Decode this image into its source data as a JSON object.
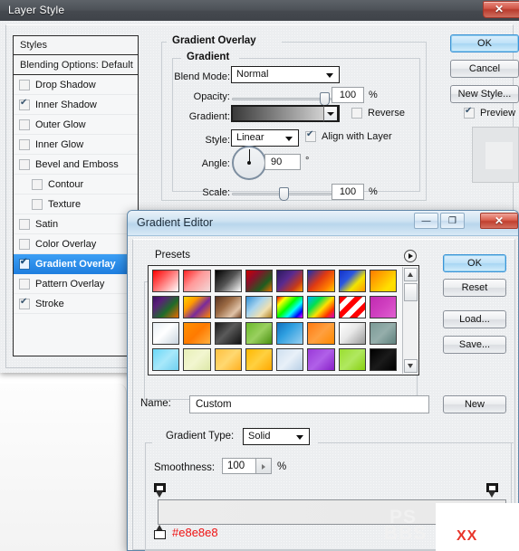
{
  "layer_style": {
    "title": "Layer Style",
    "close_glyph": "✕",
    "styles_panel": {
      "header": "Styles",
      "blending_options": "Blending Options: Default",
      "items": [
        {
          "label": "Drop Shadow",
          "checked": false,
          "indent": false,
          "selected": false
        },
        {
          "label": "Inner Shadow",
          "checked": true,
          "indent": false,
          "selected": false
        },
        {
          "label": "Outer Glow",
          "checked": false,
          "indent": false,
          "selected": false
        },
        {
          "label": "Inner Glow",
          "checked": false,
          "indent": false,
          "selected": false
        },
        {
          "label": "Bevel and Emboss",
          "checked": false,
          "indent": false,
          "selected": false
        },
        {
          "label": "Contour",
          "checked": false,
          "indent": true,
          "selected": false
        },
        {
          "label": "Texture",
          "checked": false,
          "indent": true,
          "selected": false
        },
        {
          "label": "Satin",
          "checked": false,
          "indent": false,
          "selected": false
        },
        {
          "label": "Color Overlay",
          "checked": false,
          "indent": false,
          "selected": false
        },
        {
          "label": "Gradient Overlay",
          "checked": true,
          "indent": false,
          "selected": true
        },
        {
          "label": "Pattern Overlay",
          "checked": false,
          "indent": false,
          "selected": false
        },
        {
          "label": "Stroke",
          "checked": true,
          "indent": false,
          "selected": false
        }
      ]
    },
    "panel": {
      "group_title": "Gradient Overlay",
      "subgroup_title": "Gradient",
      "blend_mode_label": "Blend Mode:",
      "blend_mode_value": "Normal",
      "opacity_label": "Opacity:",
      "opacity_value": "100",
      "opacity_unit": "%",
      "gradient_label": "Gradient:",
      "reverse_label": "Reverse",
      "reverse_checked": false,
      "style_label": "Style:",
      "style_value": "Linear",
      "align_label": "Align with Layer",
      "align_checked": true,
      "angle_label": "Angle:",
      "angle_value": "90",
      "angle_unit": "°",
      "scale_label": "Scale:",
      "scale_value": "100",
      "scale_unit": "%"
    },
    "buttons": {
      "ok": "OK",
      "cancel": "Cancel",
      "new_style": "New Style...",
      "preview_label": "Preview",
      "preview_checked": true
    }
  },
  "gradient_editor": {
    "title": "Gradient Editor",
    "window_buttons": {
      "minimize": "—",
      "maximize": "❐",
      "close": "✕"
    },
    "presets": {
      "label": "Presets",
      "menu_icon": "play-arrow-icon",
      "swatches": [
        "linear-gradient(135deg,#ff0000 0%,#ff5555 35%,#ffffff 100%)",
        "linear-gradient(135deg,#ff2222 0%,#ff9999 45%,#f2d9d9 100%)",
        "linear-gradient(135deg,#000000 0%,#555555 50%,#ffffff 100%)",
        "linear-gradient(135deg,#cc0000 0%,#8b0f2a 30%,#1f5c1f 70%,#e86a00 100%)",
        "linear-gradient(135deg,#2b1a5e 0%,#5a2a8f 40%,#c73a18 75%,#ff9900 100%)",
        "linear-gradient(135deg,#1a2fb0 0%,#e03a12 45%,#ff7a00 75%,#ffcc00 100%)",
        "linear-gradient(135deg,#1433c8 0%,#2b57e0 35%,#f2e400 65%,#ff9a00 100%)",
        "linear-gradient(135deg,#ff7a00 0%,#ffb000 40%,#ffe000 75%,#ffd400 100%)",
        "linear-gradient(135deg,#3b1060 0%,#5a1f7a 25%,#1f6b2a 60%,#e86a00 100%)",
        "linear-gradient(135deg,#ffd400 0%,#ff9a00 30%,#7a2a9a 60%,#ff8800 100%)",
        "linear-gradient(135deg,#5a3420 0%,#9c6b45 40%,#e0c3a8 75%,#7a4a2a 100%)",
        "linear-gradient(135deg,#2f8fd6 0%,#a8d4ee 40%,#f0e0b0 70%,#b08020 100%)",
        "linear-gradient(135deg,#ff0000 0%,#ffff00 20%,#00ff00 45%,#00ffff 65%,#0000ff 85%,#ff00ff 100%)",
        "linear-gradient(135deg,#00b0ff 0%,#00e050 30%,#ffe000 55%,#ff3000 80%,#cc00cc 100%)",
        "repeating-linear-gradient(135deg,#ff0000 0 6px,#ffffff 6px 12px)",
        "linear-gradient(135deg,#c02ab0 0%,#d040c0 50%,#e060d0 100%)",
        "linear-gradient(135deg,#e8eef4 0%,#ffffff 45%,#c8d4de 100%)",
        "linear-gradient(135deg,#ff9000 0%,#ff7a00 50%,#ffb040 100%)",
        "linear-gradient(135deg,#1a1a1a 0%,#5a5a5a 45%,#111111 100%)",
        "linear-gradient(135deg,#6aba2a 0%,#9ad060 50%,#4a9010 100%)",
        "linear-gradient(135deg,#1070c0 0%,#2f9fe0 40%,#9ad0f0 100%)",
        "linear-gradient(135deg,#ff7a10 0%,#ffa040 50%,#ff8800 100%)",
        "linear-gradient(135deg,#ffffff 0%,#e8e8e8 45%,#9a9a9a 100%)",
        "linear-gradient(135deg,#7a9a96 0%,#95aeab 50%,#5e807c 100%)",
        "linear-gradient(135deg,#6ad8f8 0%,#a8e8fa 50%,#70d0f0 100%)",
        "linear-gradient(135deg,#e8f0b8 0%,#f2f6d0 50%,#dde8a8 100%)",
        "linear-gradient(135deg,#ffc040 0%,#ffd870 50%,#ffb020 100%)",
        "linear-gradient(135deg,#ffb800 0%,#ffd040 50%,#ffa800 100%)",
        "linear-gradient(135deg,#cfe0f0 0%,#e8f0f8 50%,#b8cfe6 100%)",
        "linear-gradient(135deg,#9a3ad8 0%,#b060e8 50%,#8820c8 100%)",
        "linear-gradient(135deg,#9ade30 0%,#b0e860 50%,#88d010 100%)",
        "linear-gradient(135deg,#000000 0%,#1a1a1a 50%,#000000 100%)"
      ]
    },
    "buttons": {
      "ok": "OK",
      "reset": "Reset",
      "load": "Load...",
      "save": "Save...",
      "new": "New"
    },
    "name_label": "Name:",
    "name_value": "Custom",
    "gradient_type_label": "Gradient Type:",
    "gradient_type_value": "Solid",
    "smoothness_label": "Smoothness:",
    "smoothness_value": "100",
    "smoothness_unit": "%",
    "gradient_strip": {
      "css": "linear-gradient(90deg,#ececec 0%,#e9e9e9 100%)",
      "opacity_stops": [
        {
          "position": 0
        },
        {
          "position": 100
        }
      ],
      "color_stops": [
        {
          "position": 0,
          "hex": "#e8e8e8"
        }
      ]
    },
    "selected_color_hex": "#e8e8e8"
  },
  "watermark": {
    "line1": "PS",
    "line2": "BBS",
    "overlay_text": "XX"
  }
}
